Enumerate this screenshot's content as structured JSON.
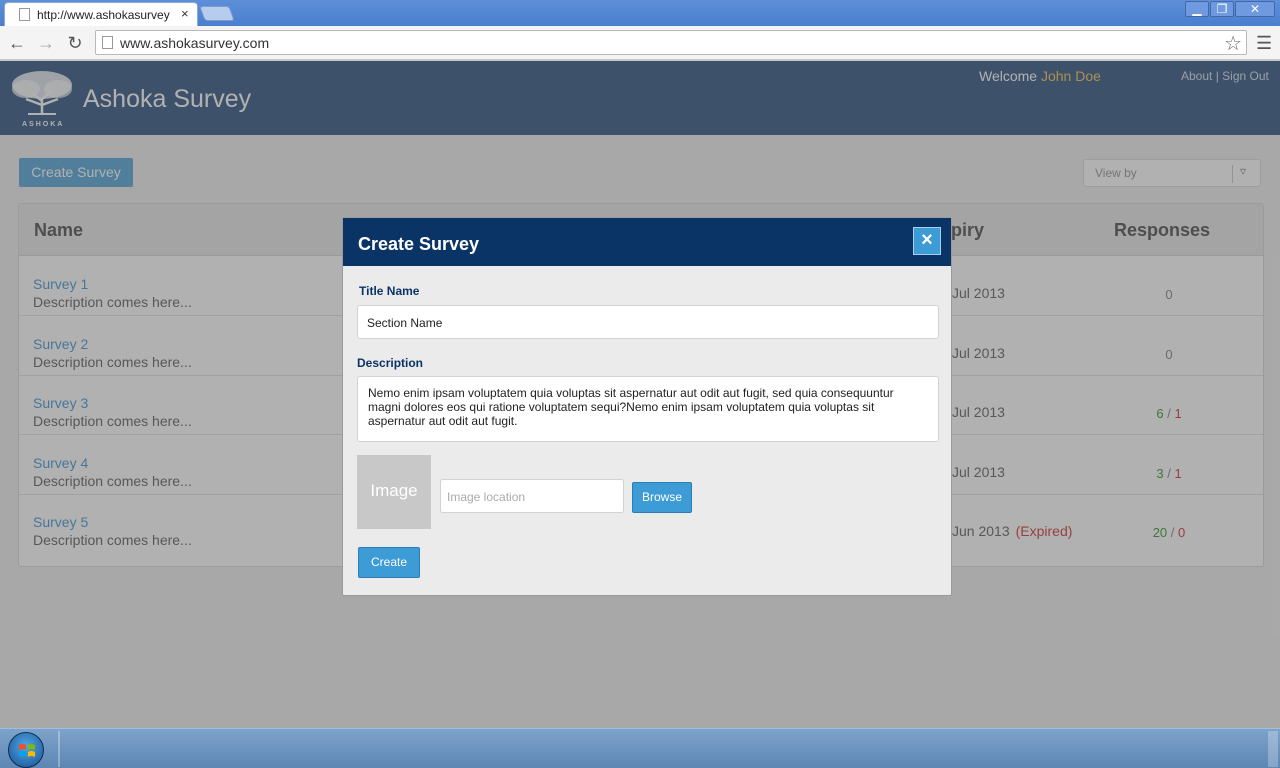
{
  "browser": {
    "tab_title": "http://www.ashokasurvey",
    "tab_close": "×",
    "url": "www.ashokasurvey.com",
    "window_buttons": {
      "minimize": "▁",
      "maximize": "❐",
      "close": "✕"
    }
  },
  "header": {
    "logo_text": "ASHOKA",
    "brand": "Ashoka Survey",
    "welcome_label": "Welcome",
    "user_name": "John Doe",
    "about": "About",
    "separator": "|",
    "sign_out": "Sign Out"
  },
  "toolbar": {
    "create_survey": "Create Survey",
    "view_by_placeholder": "View by"
  },
  "table": {
    "columns": {
      "name": "Name",
      "expiry": "Expiry",
      "responses": "Responses"
    },
    "rows": [
      {
        "name": "Survey 1",
        "description": "Description comes here...",
        "expiry": "Jul 2013",
        "expired_label": "",
        "responses_complete": "0",
        "responses_separator": "",
        "responses_incomplete": ""
      },
      {
        "name": "Survey 2",
        "description": "Description comes here...",
        "expiry": "Jul 2013",
        "expired_label": "",
        "responses_complete": "0",
        "responses_separator": "",
        "responses_incomplete": ""
      },
      {
        "name": "Survey 3",
        "description": "Description comes here...",
        "expiry": "Jul 2013",
        "expired_label": "",
        "responses_complete": "6",
        "responses_separator": "/",
        "responses_incomplete": "1"
      },
      {
        "name": "Survey 4",
        "description": "Description comes here...",
        "expiry": "Jul 2013",
        "expired_label": "",
        "responses_complete": "3",
        "responses_separator": "/",
        "responses_incomplete": "1"
      },
      {
        "name": "Survey 5",
        "description": "Description comes here...",
        "expiry": "Jun 2013",
        "expired_label": "(Expired)",
        "responses_complete": "20",
        "responses_separator": "/",
        "responses_incomplete": "0"
      }
    ]
  },
  "modal": {
    "title": "Create Survey",
    "close": "×",
    "title_label": "Title Name",
    "title_value": "Section Name",
    "description_label": "Description",
    "description_value": "Nemo enim ipsam voluptatem quia voluptas sit aspernatur aut odit aut fugit, sed quia consequuntur magni dolores eos qui ratione voluptatem sequi?Nemo enim ipsam voluptatem quia voluptas sit aspernatur aut odit aut fugit.",
    "image_placeholder": "Image",
    "image_location_placeholder": "Image location",
    "browse": "Browse",
    "create": "Create"
  },
  "colors": {
    "header_bg": "#3a5a86",
    "modal_header": "#0b3466",
    "accent_blue": "#3d9bd6",
    "user_name": "#f2c85a",
    "complete": "#3b9a3b",
    "incomplete": "#d23c3c"
  }
}
